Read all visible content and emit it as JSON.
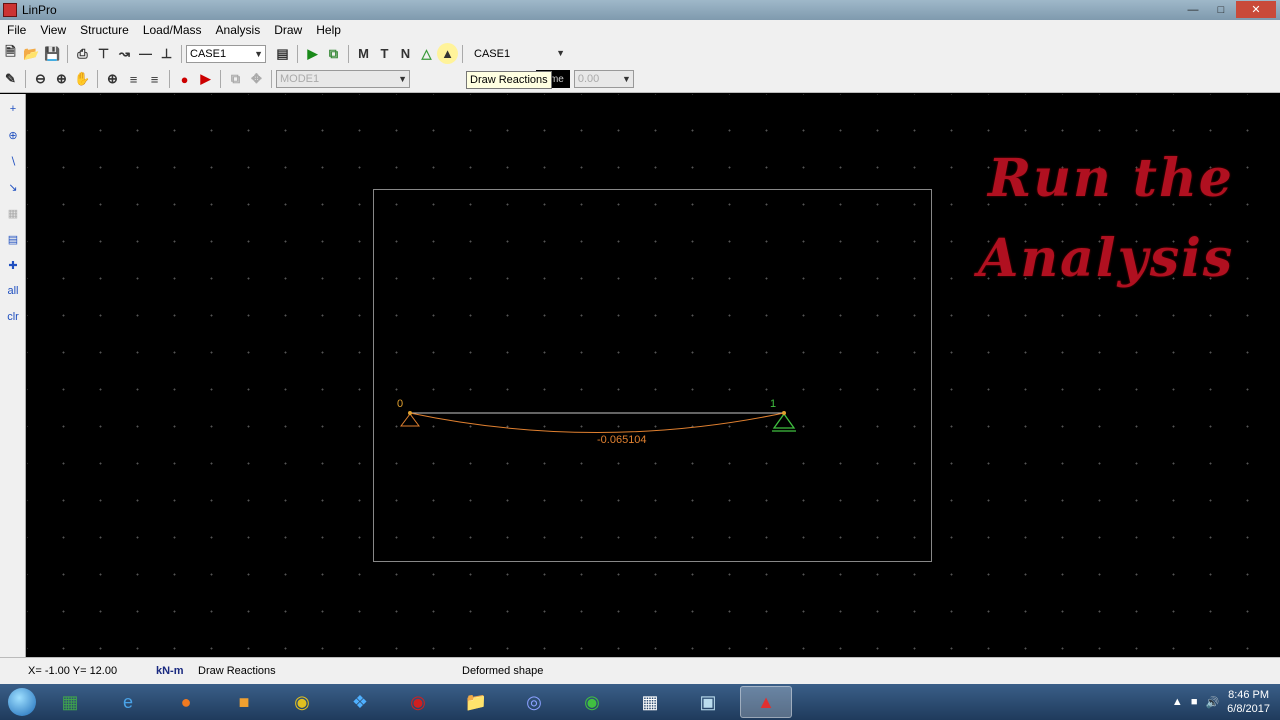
{
  "window": {
    "title": "LinPro"
  },
  "menu": [
    "File",
    "View",
    "Structure",
    "Load/Mass",
    "Analysis",
    "Draw",
    "Help"
  ],
  "toolbar1": {
    "case_combo": "CASE1",
    "case_combo2": "CASE1"
  },
  "toolbar2": {
    "mode_combo": "MODE1",
    "time_label": "Time",
    "time_value": "0.00"
  },
  "tooltip": "Draw Reactions",
  "sidebar": {
    "all": "all",
    "clr": "clr"
  },
  "model": {
    "node0": "0",
    "node1": "1",
    "deflection_label": "-0.065104"
  },
  "overlay": {
    "line1": "Run the",
    "line2": "Analysis"
  },
  "status": {
    "coords": "X= -1.00  Y= 12.00",
    "units": "kN-m",
    "action": "Draw Reactions",
    "mode": "Deformed shape"
  },
  "taskbar": {
    "time": "8:46 PM",
    "date": "6/8/2017"
  },
  "colors": {
    "overlay": "#b01020",
    "beam": "#c8c8c8",
    "deformed": "#e08030",
    "support_left": "#e08030",
    "support_right": "#40c040"
  }
}
